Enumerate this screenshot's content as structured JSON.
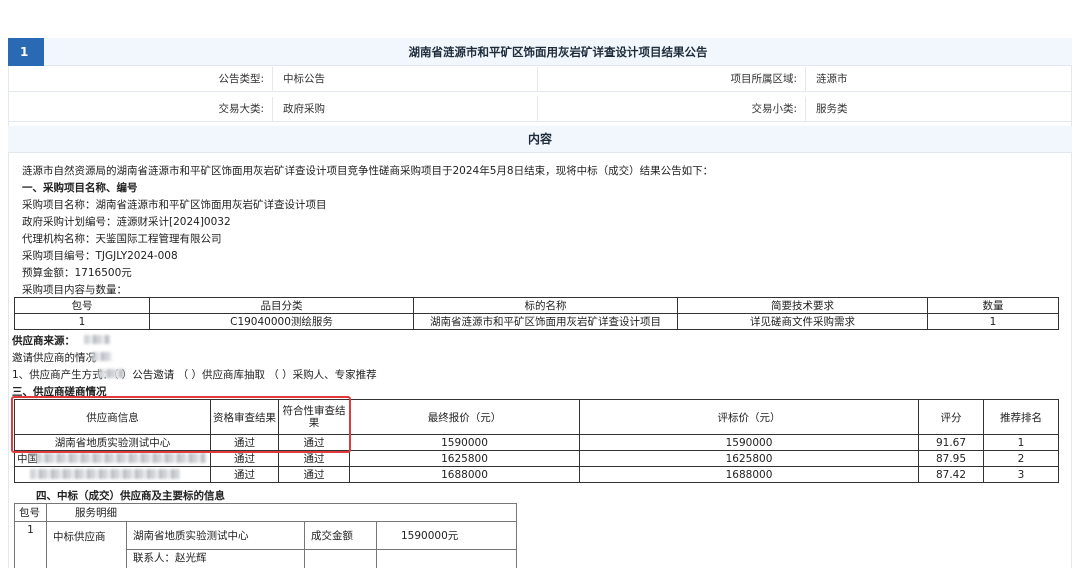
{
  "header": {
    "index": "1",
    "title": "湖南省涟源市和平矿区饰面用灰岩矿详查设计项目结果公告"
  },
  "meta": {
    "announce_type_label": "公告类型:",
    "announce_type_value": "中标公告",
    "region_label": "项目所属区域:",
    "region_value": "涟源市",
    "category_label": "交易大类:",
    "category_value": "政府采购",
    "subcategory_label": "交易小类:",
    "subcategory_value": "服务类"
  },
  "content": {
    "heading": "内容",
    "intro": "涟源市自然资源局的湖南省涟源市和平矿区饰面用灰岩矿详查设计项目竞争性磋商采购项目于2024年5月8日结束，现将中标（成交）结果公告如下：",
    "section1_title": "一、采购项目名称、编号",
    "project_name": "采购项目名称：湖南省涟源市和平矿区饰面用灰岩矿详查设计项目",
    "plan_no": "政府采购计划编号：涟源财采计[2024]0032",
    "agency": "代理机构名称：天鉴国际工程管理有限公司",
    "project_no": "采购项目编号：TJGJLY2024-008",
    "budget": "预算金额：1716500元",
    "items_label": "采购项目内容与数量："
  },
  "items_table": {
    "headers": [
      "包号",
      "品目分类",
      "标的名称",
      "简要技术要求",
      "数量"
    ],
    "rows": [
      [
        "1",
        "C19040000测绘服务",
        "湖南省涟源市和平矿区饰面用灰岩矿详查设计项目",
        "详见磋商文件采购需求",
        "1"
      ]
    ]
  },
  "source": {
    "title": "供应商来源：",
    "invite": "邀请供应商的情况",
    "method": "1、供应商产生方式：（ ）公告邀请 （ ）供应商库抽取 （ ）采购人、专家推荐"
  },
  "section3_title": "三、供应商磋商情况",
  "eval_table": {
    "headers": [
      "供应商信息",
      "资格审查结果",
      "符合性审查结果",
      "最终报价（元）",
      "评标价（元）",
      "评分",
      "推荐排名"
    ],
    "rows": [
      [
        "湖南省地质实验测试中心",
        "通过",
        "通过",
        "1590000",
        "1590000",
        "91.67",
        "1"
      ],
      [
        "中国",
        "通过",
        "通过",
        "1625800",
        "1625800",
        "87.95",
        "2"
      ],
      [
        "",
        "通过",
        "通过",
        "1688000",
        "1688000",
        "87.42",
        "3"
      ]
    ]
  },
  "section4_title": "四、中标（成交）供应商及主要标的信息",
  "award": {
    "col_pkg": "包号",
    "col_detail": "服务明细",
    "pkg_no": "1",
    "winner_label": "中标供应商",
    "winner_name": "湖南省地质实验测试中心",
    "amount_label": "成交金额",
    "amount_value": "1590000元",
    "contact": "联系人：赵光辉"
  },
  "colors": {
    "badge": "#2a6ab4",
    "header_bg": "#f1f7fc",
    "highlight_box": "#e03a3a"
  }
}
